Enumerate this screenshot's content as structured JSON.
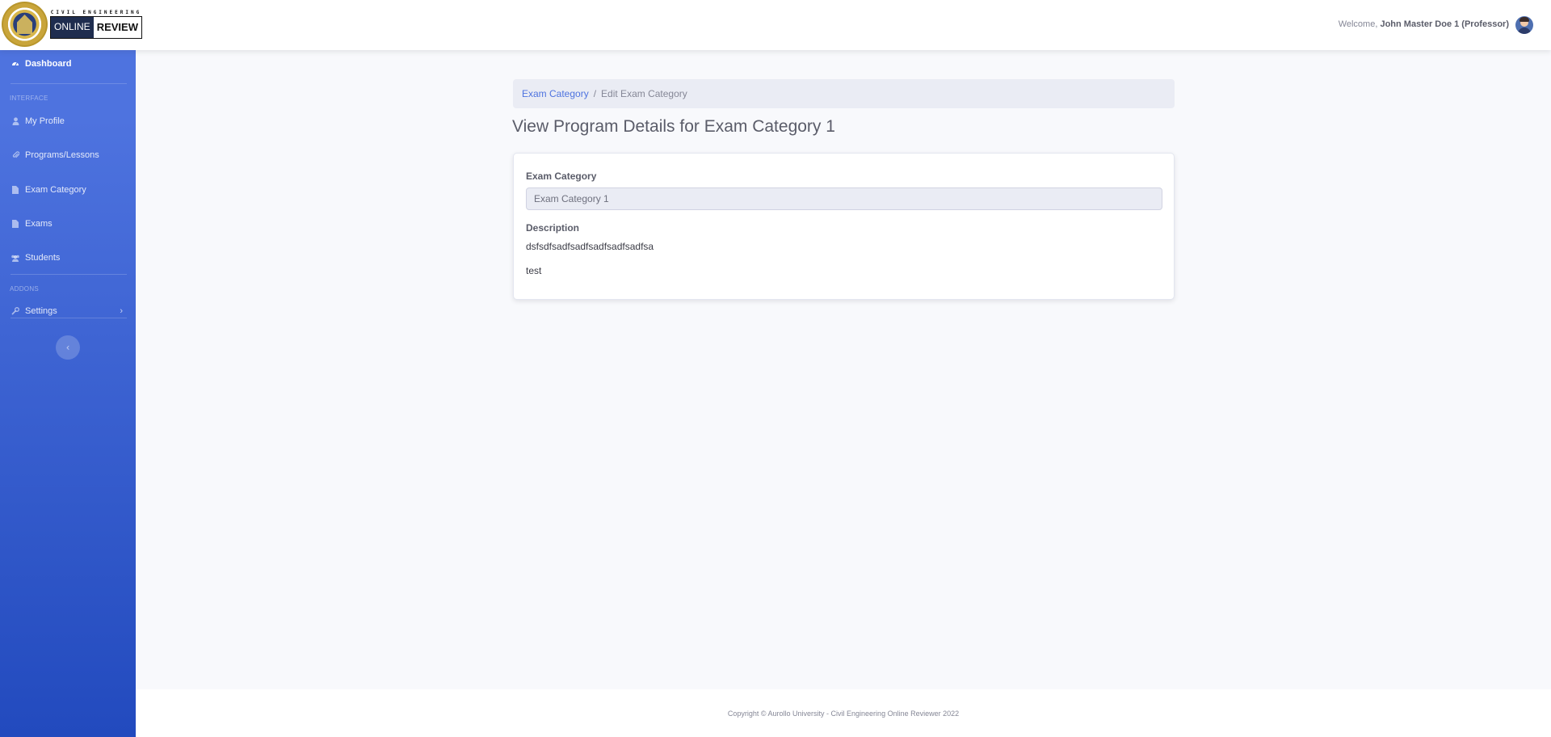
{
  "brand": {
    "top_text": "CIVIL ENGINEERING",
    "online": "ONLINE",
    "review": "REVIEW"
  },
  "topbar": {
    "welcome_prefix": "Welcome, ",
    "user_name": "John Master Doe 1 (Professor)"
  },
  "sidebar": {
    "dashboard": "Dashboard",
    "heading_interface": "INTERFACE",
    "heading_addons": "ADDONS",
    "items": [
      {
        "label": "My Profile",
        "icon": "user-icon"
      },
      {
        "label": "Programs/Lessons",
        "icon": "paperclip-icon"
      },
      {
        "label": "Exam Category",
        "icon": "file-icon"
      },
      {
        "label": "Exams",
        "icon": "file-icon"
      },
      {
        "label": "Students",
        "icon": "users-icon"
      },
      {
        "label": "Settings",
        "icon": "wrench-icon"
      }
    ]
  },
  "breadcrumb": {
    "link": "Exam Category",
    "separator": "/",
    "current": "Edit Exam Category"
  },
  "page_title": "View Program Details for Exam Category 1",
  "form": {
    "category_label": "Exam Category",
    "category_value": "Exam Category 1",
    "description_label": "Description",
    "description_lines": [
      "dsfsdfsadfsadfsadfsadfsadfsa",
      "test"
    ]
  },
  "footer": {
    "text": "Copyright © Aurollo University - Civil Engineering Online Reviewer 2022"
  },
  "colors": {
    "primary": "#4e73df",
    "sidebar_gradient_end": "#224abe",
    "background": "#f8f9fc"
  }
}
